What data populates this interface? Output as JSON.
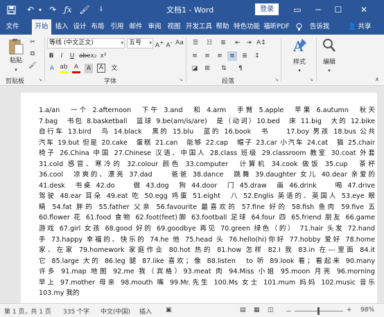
{
  "title_bar": {
    "doc_title": "文档1 - Word",
    "login_label": "登录"
  },
  "tabs": [
    "文件",
    "开始",
    "插入",
    "设计",
    "布局",
    "引用",
    "邮件",
    "审阅",
    "视图",
    "开发工具",
    "帮助",
    "特色功能",
    "福昕PDF"
  ],
  "active_tab": "开始",
  "tell_me": "告诉我",
  "share": "共享",
  "ribbon": {
    "paste_label": "粘贴",
    "clipboard_label": "剪贴板",
    "font_group_label": "字体",
    "paragraph_group_label": "段落",
    "font_name": "等线 (中文正文)",
    "font_size": "五号",
    "font_row2": [
      "wén",
      "A",
      "A",
      "Aa",
      "A",
      "A",
      "A"
    ],
    "style_label": "样式",
    "edit_label": "编辑",
    "quick_b": "B",
    "quick_i": "I",
    "quick_u": "U"
  },
  "document": {
    "lines": [
      "1.a/an　一个 2.afternoon　下午 3.and　和 4.arm　手臂 5.apple　苹果 6.autumn　秋天",
      "7.bag　书包 8.basketball　篮球 9.be(am/is/are)　是（动词）10.bed　床 11.big　大的 12.bike",
      "自行车 13.bird　鸟 14.black　黑的 15.blu　蓝的 16.book　书　　17.boy 男孩 18.bus 公共",
      "汽车 19.but 但是 20.cake　蛋糕 21.can　能够 22.cap　帽子 23.car 小汽车 24.cat　猫 25.chair",
      "椅子 26.China 中国 27.Chinese 汉语、中国人 28.class 班级 29.classroom 教室 30.coat 外套",
      "31.cold 感冒、寒冷的 32.colour 颜色 33.computer　计算机 34.cook 做饭 35.cup　茶杯",
      "36.cool　凉爽的、漂亮 37.dad　　爸爸 38.dance　跳舞 39.daughter 女儿 40.dear 亲爱的",
      "41.desk　书桌 42.do　　做 43.dog　狗 44.door　门 45.draw　画 46.drink　　喝 47.drive",
      "驾驶 48.ear 耳朵 49.eat 吃 50.egg 鸡蛋 51.eight　八 52.Englis 英语的、英国人 53.eye 眼",
      "睛 54.fat 胖的 55.father 父亲 56.favourite 最喜欢的 57.fine 好的 58.fish 鱼肉 59.five 五",
      "60.flower 花 61.food 食物 62.foot(feet)脚 63.football 足球 64.four 四 65.friend 朋友 66.game",
      "游戏 67.girl 女孩 68.good 好的 69.goodbye 再见 70.green 绿色（的） 71.hair 头发 72.hand",
      "手 73.happy 幸福的、快乐的 74.he 他 75.head 头 76.hello(hi)你好 77.hobby 爱好 78.home",
      "家、在家 79.homework 家庭作业 80.hot 热的 81.how 怎样 82.I 我 83.in 在---里面 84.it",
      "它 85.large 大的 86.leg 腿 87.like 喜欢；像 88.listen　to 听 89.look 看；看起来 90.many",
      "许多 91.map 地图 92.me 我（宾格）93.meat 肉 94.Miss 小姐 95.moon 月亮 96.morning",
      "早上 97.mother 母亲 98.mouth 嘴 99.Mr.先生 100.Ms 女士 101.mum 妈妈 102.music 音乐",
      "103.my 我的"
    ]
  },
  "status_bar": {
    "page": "第 1 页，共 1 页",
    "words": "335 个字",
    "language": "中文(中国)",
    "mode": "插入",
    "zoom_minus": "－",
    "zoom_plus": "+",
    "zoom": "98%",
    "zoom_fraction": 0.49
  }
}
